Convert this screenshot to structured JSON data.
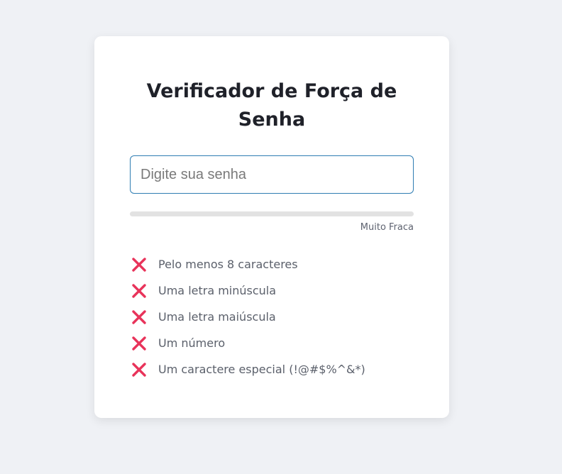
{
  "colors": {
    "page_background": "#eff1f5",
    "card_background": "#ffffff",
    "input_border_focus": "#2f7db3",
    "fail_icon": "#e8335a",
    "track": "#e2e2e2"
  },
  "card": {
    "title": "Verificador de Força de Senha",
    "password_input": {
      "value": "",
      "placeholder": "Digite sua senha"
    },
    "strength": {
      "fraction": 0,
      "label": "Muito Fraca"
    },
    "requirements": [
      {
        "label": "Pelo menos 8 caracteres",
        "met": false,
        "icon": "x-icon"
      },
      {
        "label": "Uma letra minúscula",
        "met": false,
        "icon": "x-icon"
      },
      {
        "label": "Uma letra maiúscula",
        "met": false,
        "icon": "x-icon"
      },
      {
        "label": "Um número",
        "met": false,
        "icon": "x-icon"
      },
      {
        "label": "Um caractere especial (!@#$%^&*)",
        "met": false,
        "icon": "x-icon"
      }
    ]
  }
}
